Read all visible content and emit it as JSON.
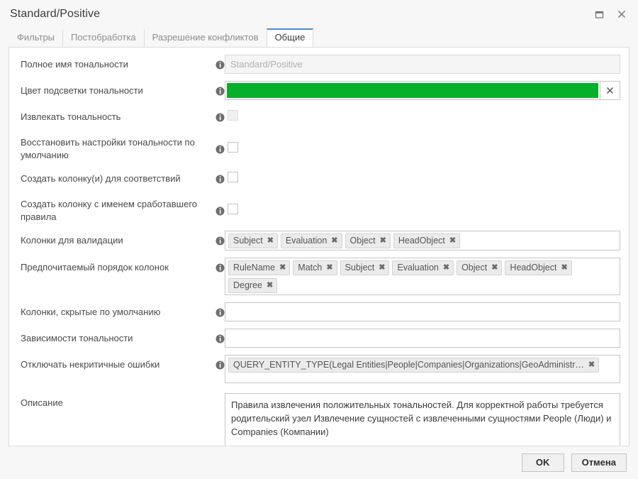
{
  "window": {
    "title": "Standard/Positive",
    "controls": [
      {
        "name": "restore-window-button",
        "icon": "restore-icon"
      },
      {
        "name": "close-window-button",
        "icon": "close-icon"
      }
    ]
  },
  "tabs": [
    {
      "label": "Фильтры",
      "active": false
    },
    {
      "label": "Постобработка",
      "active": false
    },
    {
      "label": "Разрешение конфликтов",
      "active": false
    },
    {
      "label": "Общие",
      "active": true
    }
  ],
  "form": {
    "full_name": {
      "label": "Полное имя тональности",
      "placeholder": "Standard/Positive",
      "value": "",
      "disabled": true
    },
    "highlight_color": {
      "label": "Цвет подсветки тональности",
      "color": "#06b02a",
      "clear_label": "✕"
    },
    "extract_tonality": {
      "label": "Извлекать тональность",
      "checked": false,
      "disabled": true
    },
    "restore_defaults": {
      "label": "Восстановить настройки тональности по умолчанию",
      "checked": false,
      "disabled": false
    },
    "create_match_columns": {
      "label": "Создать колонку(и) для соответствий",
      "checked": false,
      "disabled": false
    },
    "create_rule_name_column": {
      "label": "Создать колонку с именем сработавшего правила",
      "checked": false,
      "disabled": false
    },
    "validation_columns": {
      "label": "Колонки для валидации",
      "chips": [
        "Subject",
        "Evaluation",
        "Object",
        "HeadObject"
      ]
    },
    "preferred_column_order": {
      "label": "Предпочитаемый порядок колонок",
      "chips": [
        "RuleName",
        "Match",
        "Subject",
        "Evaluation",
        "Object",
        "HeadObject",
        "Degree"
      ]
    },
    "hidden_columns": {
      "label": "Колонки, скрытые по умолчанию",
      "value": ""
    },
    "tonality_dependencies": {
      "label": "Зависимости тональности",
      "value": ""
    },
    "suppress_noncritical_errors": {
      "label": "Отключать некритичные ошибки",
      "chips": [
        "QUERY_ENTITY_TYPE(Legal Entities|People|Companies|Organizations|GeoAdministr…"
      ]
    },
    "description": {
      "label": "Описание",
      "value": "Правила извлечения положительных тональностей. Для корректной работы требуется родительский узел Извлечение сущностей с извлеченными сущностями People (Люди) и Companies (Компании)"
    },
    "chip_remove_glyph": "✖"
  },
  "footer": {
    "ok_label": "OK",
    "cancel_label": "Отмена"
  }
}
